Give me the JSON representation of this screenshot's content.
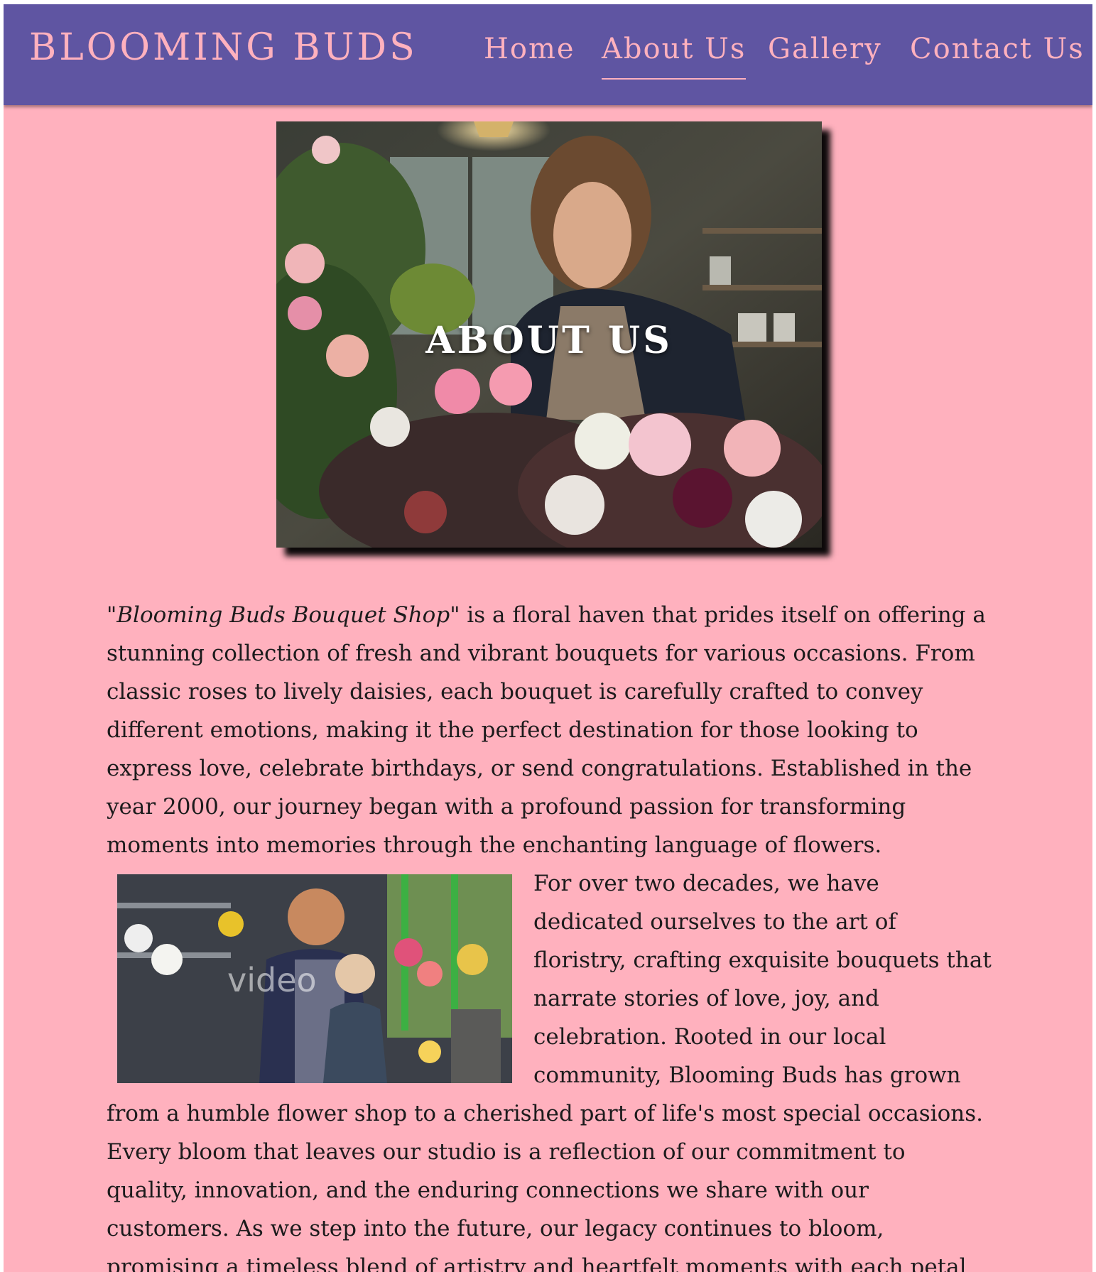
{
  "header": {
    "brand": "BLOOMING BUDS",
    "nav": [
      {
        "label": "Home",
        "active": false
      },
      {
        "label": "About Us",
        "active": true
      },
      {
        "label": "Gallery",
        "active": false
      },
      {
        "label": "Contact Us",
        "active": false
      }
    ]
  },
  "hero": {
    "title": "ABOUT US",
    "image": "florist-arranging-flowers-photo"
  },
  "about": {
    "shop_name": "\"Blooming Buds Bouquet Shop\"",
    "intro": " is a floral haven that prides itself on offering a stunning collection of fresh and vibrant bouquets for various occasions. From classic roses to lively daisies, each bouquet is carefully crafted to convey different emotions, making it the perfect destination for those looking to express love, celebrate birthdays, or send congratulations. Established in the year 2000, our journey began with a profound passion for transforming moments into memories through the enchanting language of flowers.",
    "story": "For over two decades, we have dedicated ourselves to the art of floristry, crafting exquisite bouquets that narrate stories of love, joy, and celebration. Rooted in our local community, Blooming Buds has grown from a humble flower shop to a cherished part of life's most special occasions. Every bloom that leaves our studio is a reflection of our commitment to quality, innovation, and the enduring connections we share with our customers. As we step into the future, our legacy continues to bloom, promising a timeless blend of artistry and heartfelt moments with each petal we arrange. Thank",
    "side_image": "florists-working-in-shop-photo",
    "watermark": "video"
  },
  "colors": {
    "nav_bg": "#5f55a2",
    "accent_pink": "#ffb1be",
    "page_bg": "#ffb1be",
    "text": "#1c1b1c"
  }
}
